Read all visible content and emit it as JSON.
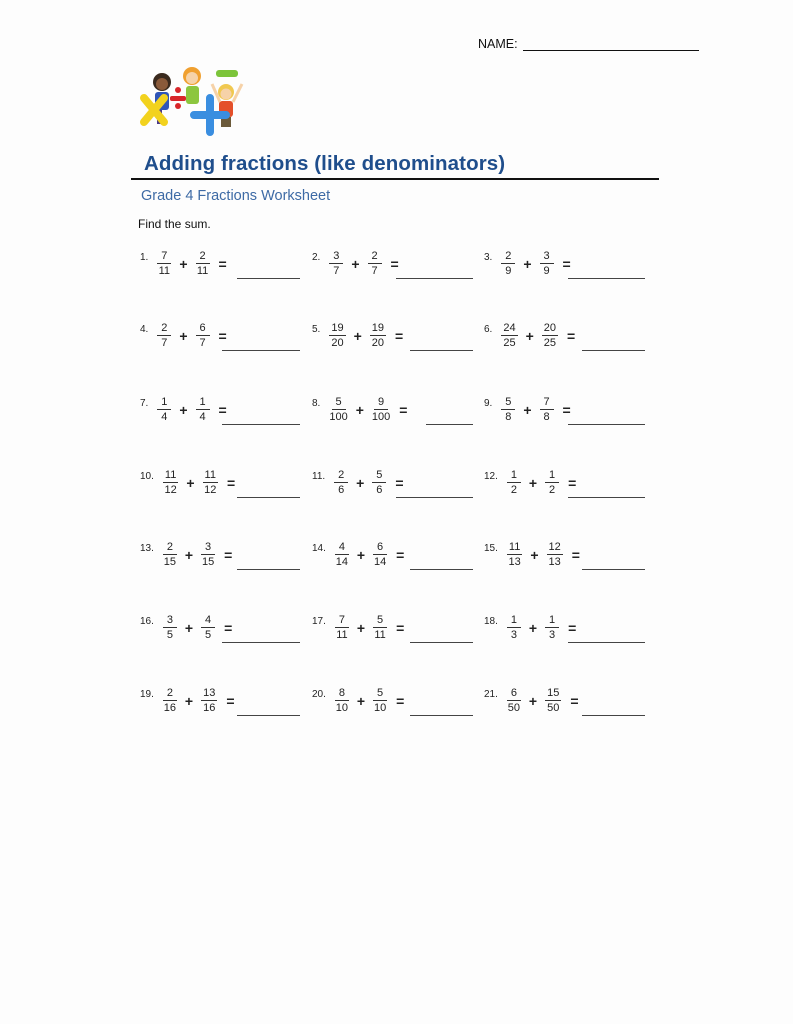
{
  "header": {
    "name_label": "NAME:",
    "title": "Adding fractions (like denominators)",
    "subtitle": "Grade 4 Fractions Worksheet",
    "instruction": "Find the sum.",
    "logo_icon": "kids-math-symbols-illustration",
    "title_color": "#1f4e8c",
    "subtitle_color": "#3d6aa5"
  },
  "problems": [
    {
      "number": "1.",
      "a_num": "7",
      "a_den": "11",
      "b_num": "2",
      "b_den": "11",
      "operator": "+",
      "equals": "="
    },
    {
      "number": "2.",
      "a_num": "3",
      "a_den": "7",
      "b_num": "2",
      "b_den": "7",
      "operator": "+",
      "equals": "="
    },
    {
      "number": "3.",
      "a_num": "2",
      "a_den": "9",
      "b_num": "3",
      "b_den": "9",
      "operator": "+",
      "equals": "="
    },
    {
      "number": "4.",
      "a_num": "2",
      "a_den": "7",
      "b_num": "6",
      "b_den": "7",
      "operator": "+",
      "equals": "="
    },
    {
      "number": "5.",
      "a_num": "19",
      "a_den": "20",
      "b_num": "19",
      "b_den": "20",
      "operator": "+",
      "equals": "="
    },
    {
      "number": "6.",
      "a_num": "24",
      "a_den": "25",
      "b_num": "20",
      "b_den": "25",
      "operator": "+",
      "equals": "="
    },
    {
      "number": "7.",
      "a_num": "1",
      "a_den": "4",
      "b_num": "1",
      "b_den": "4",
      "operator": "+",
      "equals": "="
    },
    {
      "number": "8.",
      "a_num": "5",
      "a_den": "100",
      "b_num": "9",
      "b_den": "100",
      "operator": "+",
      "equals": "="
    },
    {
      "number": "9.",
      "a_num": "5",
      "a_den": "8",
      "b_num": "7",
      "b_den": "8",
      "operator": "+",
      "equals": "="
    },
    {
      "number": "10.",
      "a_num": "11",
      "a_den": "12",
      "b_num": "11",
      "b_den": "12",
      "operator": "+",
      "equals": "="
    },
    {
      "number": "11.",
      "a_num": "2",
      "a_den": "6",
      "b_num": "5",
      "b_den": "6",
      "operator": "+",
      "equals": "="
    },
    {
      "number": "12.",
      "a_num": "1",
      "a_den": "2",
      "b_num": "1",
      "b_den": "2",
      "operator": "+",
      "equals": "="
    },
    {
      "number": "13.",
      "a_num": "2",
      "a_den": "15",
      "b_num": "3",
      "b_den": "15",
      "operator": "+",
      "equals": "="
    },
    {
      "number": "14.",
      "a_num": "4",
      "a_den": "14",
      "b_num": "6",
      "b_den": "14",
      "operator": "+",
      "equals": "="
    },
    {
      "number": "15.",
      "a_num": "11",
      "a_den": "13",
      "b_num": "12",
      "b_den": "13",
      "operator": "+",
      "equals": "="
    },
    {
      "number": "16.",
      "a_num": "3",
      "a_den": "5",
      "b_num": "4",
      "b_den": "5",
      "operator": "+",
      "equals": "="
    },
    {
      "number": "17.",
      "a_num": "7",
      "a_den": "11",
      "b_num": "5",
      "b_den": "11",
      "operator": "+",
      "equals": "="
    },
    {
      "number": "18.",
      "a_num": "1",
      "a_den": "3",
      "b_num": "1",
      "b_den": "3",
      "operator": "+",
      "equals": "="
    },
    {
      "number": "19.",
      "a_num": "2",
      "a_den": "16",
      "b_num": "13",
      "b_den": "16",
      "operator": "+",
      "equals": "="
    },
    {
      "number": "20.",
      "a_num": "8",
      "a_den": "10",
      "b_num": "5",
      "b_den": "10",
      "operator": "+",
      "equals": "="
    },
    {
      "number": "21.",
      "a_num": "6",
      "a_den": "50",
      "b_num": "15",
      "b_den": "50",
      "operator": "+",
      "equals": "="
    }
  ]
}
